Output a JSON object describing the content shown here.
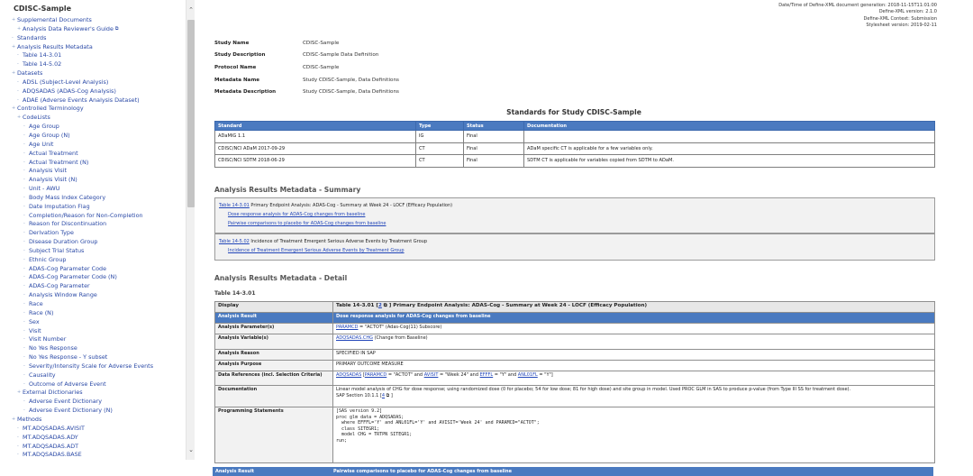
{
  "sidebar": {
    "title": "CDISC-Sample",
    "items": [
      {
        "level": 0,
        "marker": "+",
        "label": "Supplemental Documents"
      },
      {
        "level": 1,
        "marker": "+",
        "label": "Analysis Data Reviewer's Guide",
        "ext": "⧉"
      },
      {
        "level": 0,
        "marker": "-",
        "label": "Standards"
      },
      {
        "level": 0,
        "marker": "+",
        "label": "Analysis Results Metadata"
      },
      {
        "level": 1,
        "marker": "-",
        "label": "Table 14-3.01"
      },
      {
        "level": 1,
        "marker": "-",
        "label": "Table 14-5.02"
      },
      {
        "level": 0,
        "marker": "+",
        "label": "Datasets"
      },
      {
        "level": 1,
        "marker": "-",
        "label": "ADSL (Subject-Level Analysis)"
      },
      {
        "level": 1,
        "marker": "-",
        "label": "ADQSADAS (ADAS-Cog Analysis)"
      },
      {
        "level": 1,
        "marker": "-",
        "label": "ADAE (Adverse Events Analysis Dataset)"
      },
      {
        "level": 0,
        "marker": "+",
        "label": "Controlled Terminology"
      },
      {
        "level": 1,
        "marker": "+",
        "label": "CodeLists"
      },
      {
        "level": 2,
        "marker": "-",
        "label": "Age Group"
      },
      {
        "level": 2,
        "marker": "-",
        "label": "Age Group (N)"
      },
      {
        "level": 2,
        "marker": "-",
        "label": "Age Unit"
      },
      {
        "level": 2,
        "marker": "-",
        "label": "Actual Treatment"
      },
      {
        "level": 2,
        "marker": "-",
        "label": "Actual Treatment (N)"
      },
      {
        "level": 2,
        "marker": "-",
        "label": "Analysis Visit"
      },
      {
        "level": 2,
        "marker": "-",
        "label": "Analysis Visit (N)"
      },
      {
        "level": 2,
        "marker": "-",
        "label": "Unit - AWU"
      },
      {
        "level": 2,
        "marker": "-",
        "label": "Body Mass Index Category"
      },
      {
        "level": 2,
        "marker": "-",
        "label": "Date Imputation Flag"
      },
      {
        "level": 2,
        "marker": "-",
        "label": "Completion/Reason for Non-Completion"
      },
      {
        "level": 2,
        "marker": "-",
        "label": "Reason for Discontinuation"
      },
      {
        "level": 2,
        "marker": "-",
        "label": "Derivation Type"
      },
      {
        "level": 2,
        "marker": "-",
        "label": "Disease Duration Group"
      },
      {
        "level": 2,
        "marker": "-",
        "label": "Subject Trial Status"
      },
      {
        "level": 2,
        "marker": "-",
        "label": "Ethnic Group"
      },
      {
        "level": 2,
        "marker": "-",
        "label": "ADAS-Cog Parameter Code"
      },
      {
        "level": 2,
        "marker": "-",
        "label": "ADAS-Cog Parameter Code (N)"
      },
      {
        "level": 2,
        "marker": "-",
        "label": "ADAS-Cog Parameter"
      },
      {
        "level": 2,
        "marker": "-",
        "label": "Analysis Window Range"
      },
      {
        "level": 2,
        "marker": "-",
        "label": "Race"
      },
      {
        "level": 2,
        "marker": "-",
        "label": "Race (N)"
      },
      {
        "level": 2,
        "marker": "-",
        "label": "Sex"
      },
      {
        "level": 2,
        "marker": "-",
        "label": "Visit"
      },
      {
        "level": 2,
        "marker": "-",
        "label": "Visit Number"
      },
      {
        "level": 2,
        "marker": "-",
        "label": "No Yes Response"
      },
      {
        "level": 2,
        "marker": "-",
        "label": "No Yes Response - Y subset"
      },
      {
        "level": 2,
        "marker": "-",
        "label": "Severity/Intensity Scale for Adverse Events"
      },
      {
        "level": 2,
        "marker": "-",
        "label": "Causality"
      },
      {
        "level": 2,
        "marker": "-",
        "label": "Outcome of Adverse Event"
      },
      {
        "level": 1,
        "marker": "+",
        "label": "External Dictionaries"
      },
      {
        "level": 2,
        "marker": "-",
        "label": "Adverse Event Dictionary"
      },
      {
        "level": 2,
        "marker": "-",
        "label": "Adverse Event Dictionary (N)"
      },
      {
        "level": 0,
        "marker": "+",
        "label": "Methods"
      },
      {
        "level": 1,
        "marker": "-",
        "label": "MT.ADQSADAS.AVISIT"
      },
      {
        "level": 1,
        "marker": "-",
        "label": "MT.ADQSADAS.ADY"
      },
      {
        "level": 1,
        "marker": "-",
        "label": "MT.ADQSADAS.ADT"
      },
      {
        "level": 1,
        "marker": "-",
        "label": "MT.ADQSADAS.BASE"
      }
    ]
  },
  "gen_info": [
    "Date/Time of Define-XML document generation: 2018-11-15T11:01:00",
    "Define-XML version: 2.1.0",
    "Define-XML Context: Submission",
    "Stylesheet version: 2019-02-11"
  ],
  "study": [
    {
      "key": "Study Name",
      "value": "CDISC-Sample"
    },
    {
      "key": "Study Description",
      "value": "CDISC-Sample Data Definition"
    },
    {
      "key": "Protocol Name",
      "value": "CDISC-Sample"
    },
    {
      "key": "Metadata Name",
      "value": "Study CDISC-Sample, Data Definitions"
    },
    {
      "key": "Metadata Description",
      "value": "Study CDISC-Sample, Data Definitions"
    }
  ],
  "standards": {
    "title": "Standards for Study CDISC-Sample",
    "headers": [
      "Standard",
      "Type",
      "Status",
      "Documentation"
    ],
    "rows": [
      [
        "ADaMIG 1.1",
        "IG",
        "Final",
        ""
      ],
      [
        "CDISC/NCI ADaM 2017-09-29",
        "CT",
        "Final",
        "ADaM specific CT is applicable for a few variables only."
      ],
      [
        "CDISC/NCI SDTM 2018-06-29",
        "CT",
        "Final",
        "SDTM CT is applicable for variables copied from SDTM to ADaM."
      ]
    ]
  },
  "arm_summary": {
    "title": "Analysis Results Metadata - Summary",
    "groups": [
      {
        "link": "Table 14-3.01",
        "text": " Primary Endpoint Analysis: ADAS-Cog - Summary at Week 24 - LOCF (Efficacy Population)",
        "subs": [
          "Dose response analysis for ADAS-Cog changes from baseline",
          "Pairwise comparisons to placebo for ADAS-Cog changes from baseline"
        ]
      },
      {
        "link": "Table 14-5.02",
        "text": " Incidence of Treatment Emergent Serious Adverse Events by Treatment Group",
        "subs": [
          "Incidence of Treatment Emergent Serious Adverse Events by Treatment Group"
        ]
      }
    ]
  },
  "arm_detail": {
    "title": "Analysis Results Metadata - Detail",
    "table_label": "Table 14-3.01",
    "display_key": "Display",
    "display_prefix": "Table 14-3.01 [",
    "display_link": "2",
    "display_suffix": " ⧉ ] Primary Endpoint Analysis: ADAS-Cog - Summary at Week 24 - LOCF (Efficacy Population)",
    "result_key": "Analysis Result",
    "result_value": "Dose response analysis for ADAS-Cog changes from baseline",
    "param_key": "Analysis Parameter(s)",
    "param_link": "PARAMCD",
    "param_rest": " = \"ACTOT\" (Adas-Cog(11) Subscore)",
    "var_key": "Analysis Variable(s)",
    "var_link": "ADQSADAS.CHG",
    "var_rest": " (Change from Baseline)",
    "reason_key": "Analysis Reason",
    "reason_value": "SPECIFIED IN SAP",
    "purpose_key": "Analysis Purpose",
    "purpose_value": "PRIMARY OUTCOME MEASURE",
    "dataref_key": "Data References (incl. Selection Criteria)",
    "dataref_ds": "ADQSADAS",
    "dataref_p1": " [",
    "dataref_l1": "PARAMCD",
    "dataref_p2": " = \"ACTOT\" and ",
    "dataref_l2": "AVISIT",
    "dataref_p3": " = \"Week 24\" and ",
    "dataref_l3": "EFFFL",
    "dataref_p4": " = \"Y\" and ",
    "dataref_l4": "ANL01FL",
    "dataref_p5": " = \"Y\"]",
    "doc_key": "Documentation",
    "doc_line1": "Linear model analysis of CHG for dose response; using randomized dose (0 for placebo; 54 for low dose; 81 for high dose) and site group in model. Used PROC GLM in SAS to produce p-value (from Type III SS for treatment dose).",
    "doc_line2_prefix": "SAP Section 10.1.1 [",
    "doc_line2_link": "4",
    "doc_line2_suffix": " ⧉ ]",
    "prog_key": "Programming Statements",
    "prog_code": "[SAS version 9.2]\nproc glm data = ADQSADAS;\n  where EFFFL='Y' and ANL01FL='Y' and AVISIT='Week 24' and PARAMCD=\"ACTOT\";\n  class SITEGR1;\n  model CHG = TRTPN SITEGR1;\nrun;",
    "next_key": "Analysis Result",
    "next_value": "Pairwise comparisons to placebo for ADAS-Cog changes from baseline"
  },
  "colors": {
    "accent": "#4a7ac0",
    "link": "#2145b8"
  }
}
